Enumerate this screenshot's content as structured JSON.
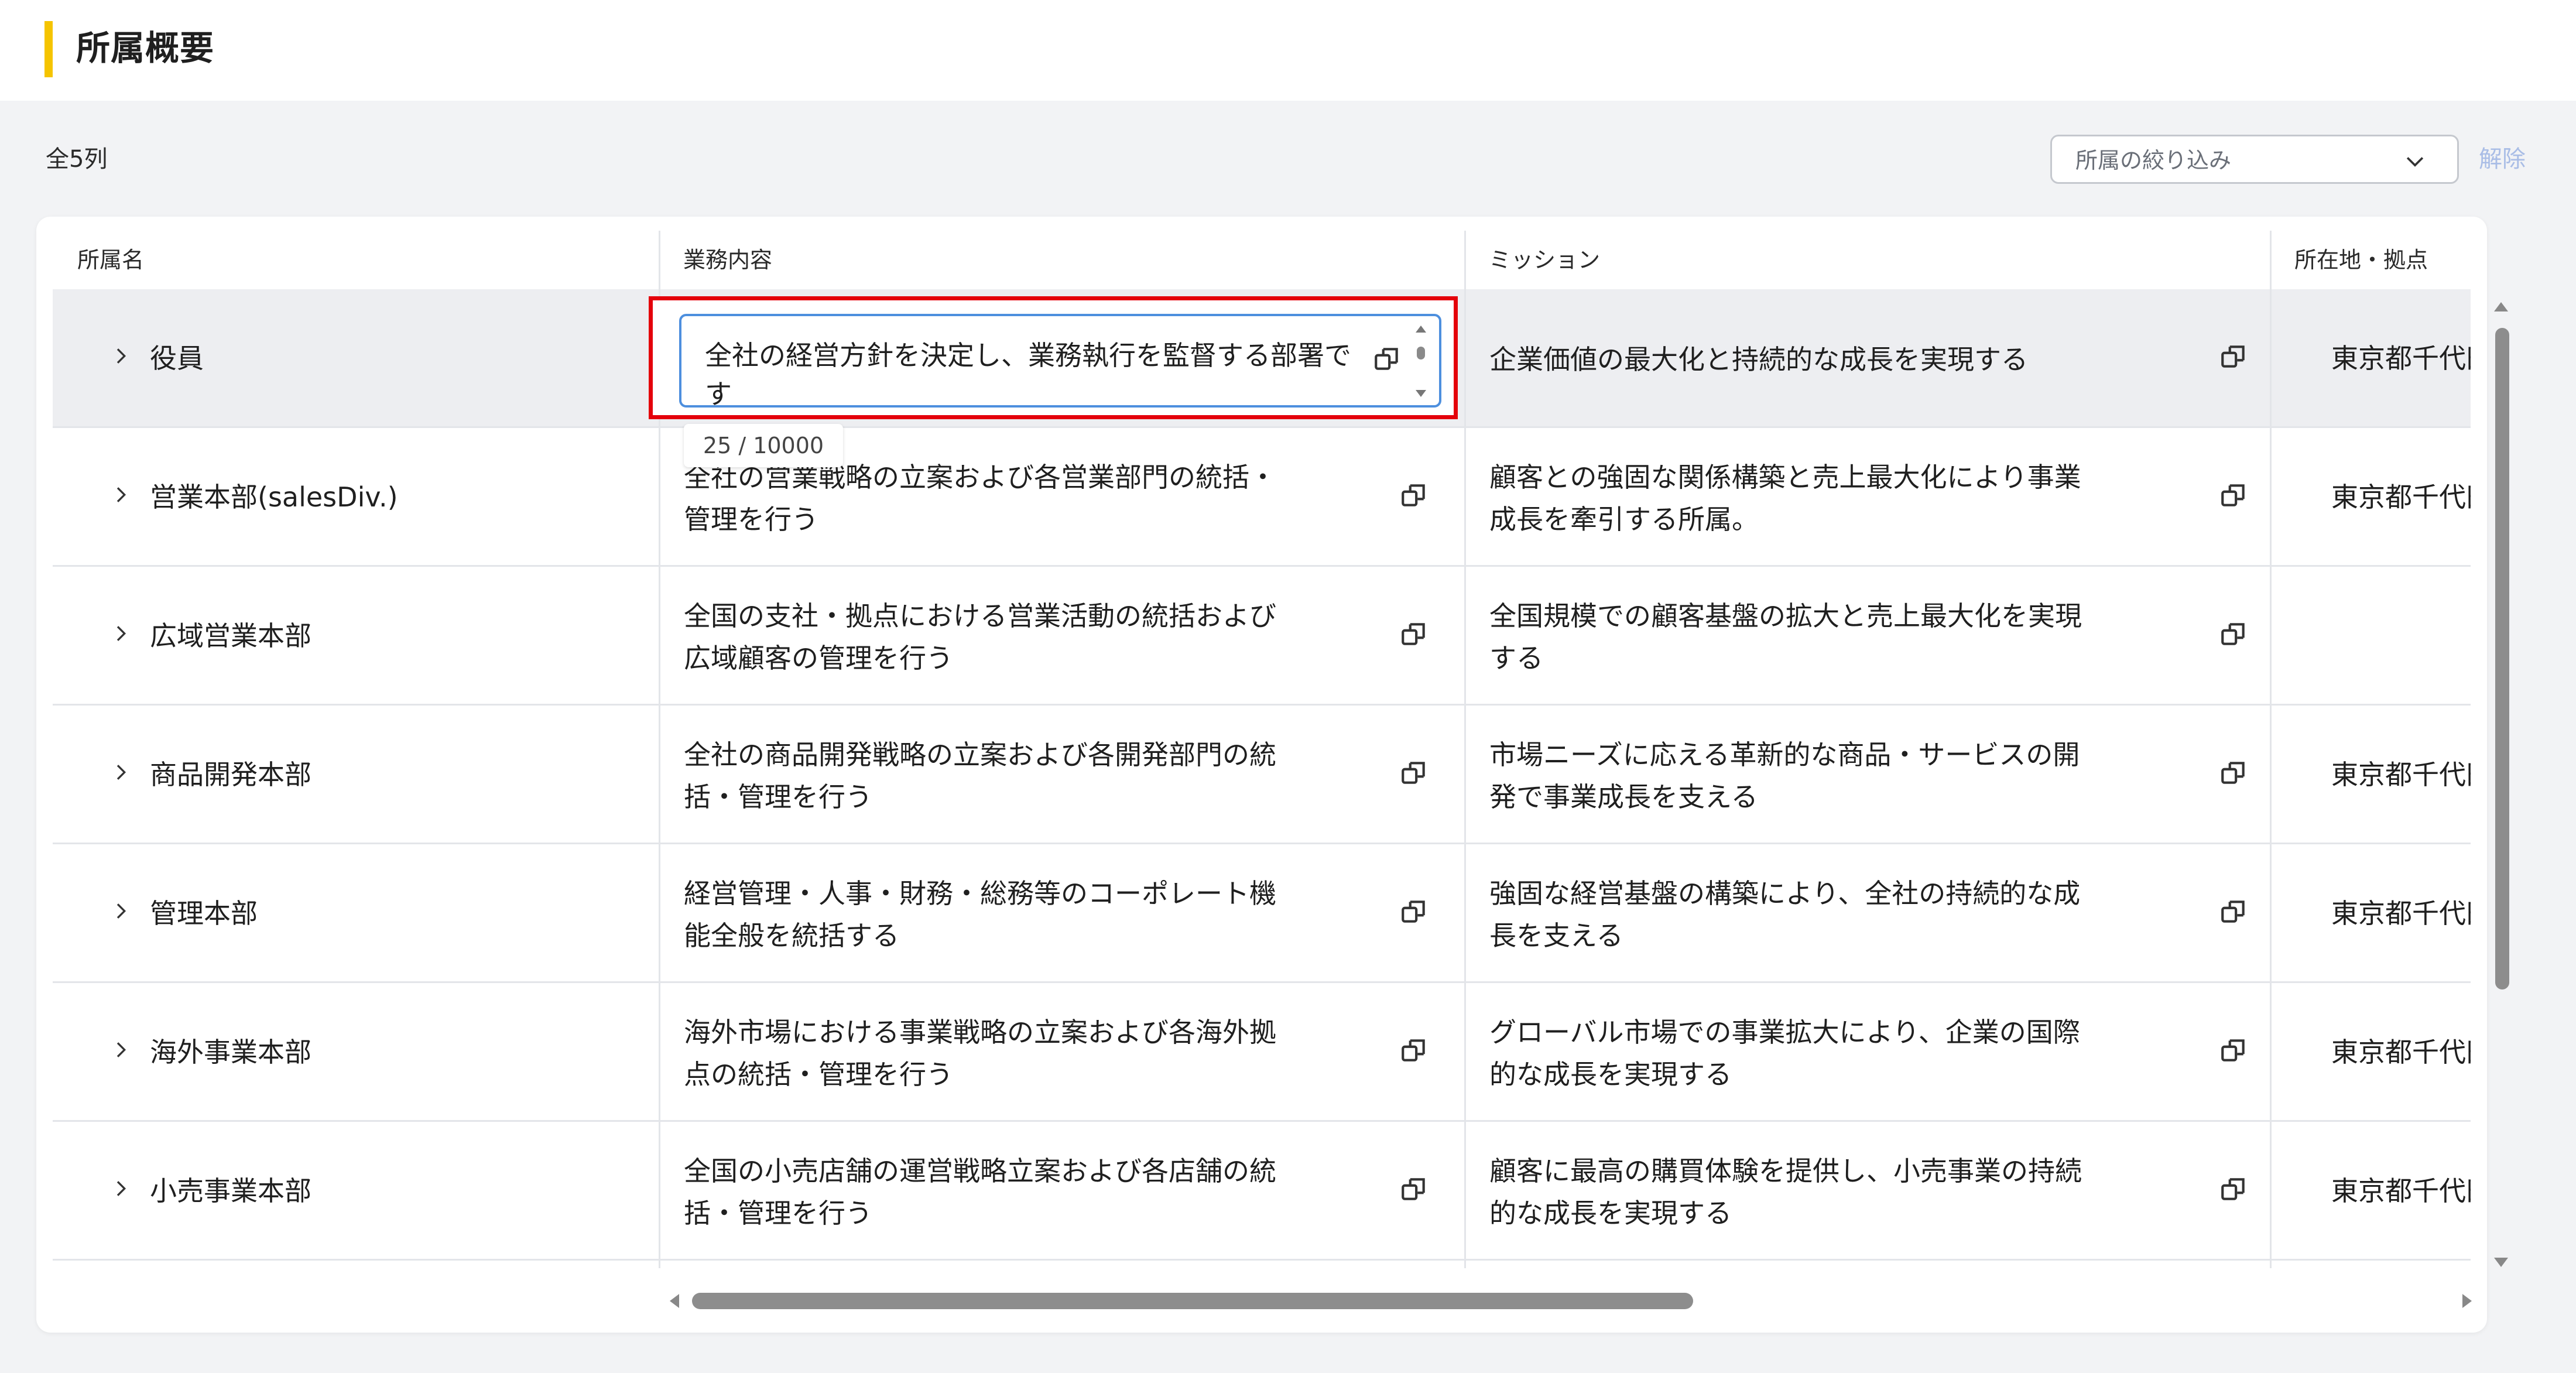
{
  "header": {
    "title": "所属概要"
  },
  "toolbar": {
    "count": "全5列",
    "filter_placeholder": "所属の絞り込み",
    "clear_label": "解除"
  },
  "columns": [
    "所属名",
    "業務内容",
    "ミッション",
    "所在地・拠点"
  ],
  "editor": {
    "value": "全社の経営方針を決定し、業務執行を監督する部署です",
    "counter": "25 / 10000"
  },
  "rows": [
    {
      "name": "役員",
      "business": "",
      "mission": "企業価値の最大化と持続的な成長を実現する",
      "location": "東京都千代田区"
    },
    {
      "name": "営業本部(salesDiv.)",
      "business": "全社の営業戦略の立案および各営業部門の統括・\n管理を行う",
      "mission": "顧客との強固な関係構築と売上最大化により事業\n成長を牽引する所属。",
      "location": "東京都千代田区"
    },
    {
      "name": "広域営業本部",
      "business": "全国の支社・拠点における営業活動の統括および\n広域顧客の管理を行う",
      "mission": "全国規模での顧客基盤の拡大と売上最大化を実現\nする",
      "location": ""
    },
    {
      "name": "商品開発本部",
      "business": "全社の商品開発戦略の立案および各開発部門の統\n括・管理を行う",
      "mission": "市場ニーズに応える革新的な商品・サービスの開\n発で事業成長を支える",
      "location": "東京都千代田区"
    },
    {
      "name": "管理本部",
      "business": "経営管理・人事・財務・総務等のコーポレート機\n能全般を統括する",
      "mission": "強固な経営基盤の構築により、全社の持続的な成\n長を支える",
      "location": "東京都千代田区"
    },
    {
      "name": "海外事業本部",
      "business": "海外市場における事業戦略の立案および各海外拠\n点の統括・管理を行う",
      "mission": "グローバル市場での事業拡大により、企業の国際\n的な成長を実現する",
      "location": "東京都千代田区"
    },
    {
      "name": "小売事業本部",
      "business": "全国の小売店舗の運営戦略立案および各店舗の統\n括・管理を行う",
      "mission": "顧客に最高の購買体験を提供し、小売事業の持続\n的な成長を実現する",
      "location": "東京都千代田区"
    }
  ],
  "icons": {
    "expander": "chevron-right-icon",
    "expand": "open-in-new-icon",
    "select": "chevron-down-icon"
  },
  "colors": {
    "accent": "#f5c400",
    "highlight": "#e4000b",
    "focus": "#4d8fde",
    "link_disabled": "#a9bde6"
  }
}
